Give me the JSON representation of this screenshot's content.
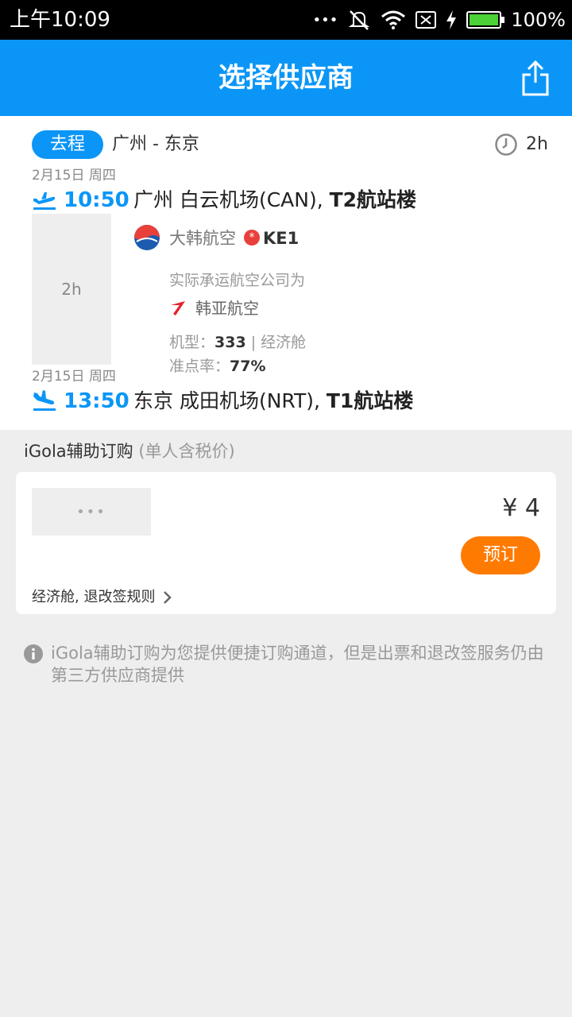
{
  "status_bar": {
    "time": "上午10:09",
    "dots": "•••",
    "battery_pct": "100%",
    "icons": [
      "mute-icon",
      "wifi-icon",
      "no-sim-icon",
      "charging-icon",
      "battery-icon"
    ]
  },
  "header": {
    "title": "选择供应商",
    "share_icon": "share-icon"
  },
  "flight": {
    "trip_badge": "去程",
    "route": "广州 - 东京",
    "duration": "2h",
    "departure": {
      "date": "2月15日 周四",
      "time": "10:50",
      "airport": "广州 白云机场(CAN), ",
      "terminal": "T2航站楼"
    },
    "middle_duration": "2h",
    "airline": {
      "name": "大韩航空",
      "codeshare_mark": "*",
      "flight_no": "KE1",
      "operator_label": "实际承运航空公司为",
      "operator_name": "韩亚航空",
      "aircraft_label": "机型：",
      "aircraft": "333",
      "sep": " | ",
      "cabin": "经济舱",
      "ontime_label": "准点率：",
      "ontime": "77%"
    },
    "arrival": {
      "date": "2月15日 周四",
      "time": "13:50",
      "airport": "东京 成田机场(NRT), ",
      "terminal": "T1航站楼"
    }
  },
  "section": {
    "title": "iGola辅助订购",
    "subtitle": "(单人含税价)"
  },
  "supplier": {
    "logo_placeholder": "•••",
    "price": "¥ 4",
    "book_label": "预订",
    "rules_label": "经济舱, 退改签规则"
  },
  "notice": {
    "text": "iGola辅助订购为您提供便捷订购通道，但是出票和退改签服务仍由第三方供应商提供"
  },
  "colors": {
    "primary": "#0b96f7",
    "book_button": "#ff7a00",
    "background": "#eeeeee"
  }
}
